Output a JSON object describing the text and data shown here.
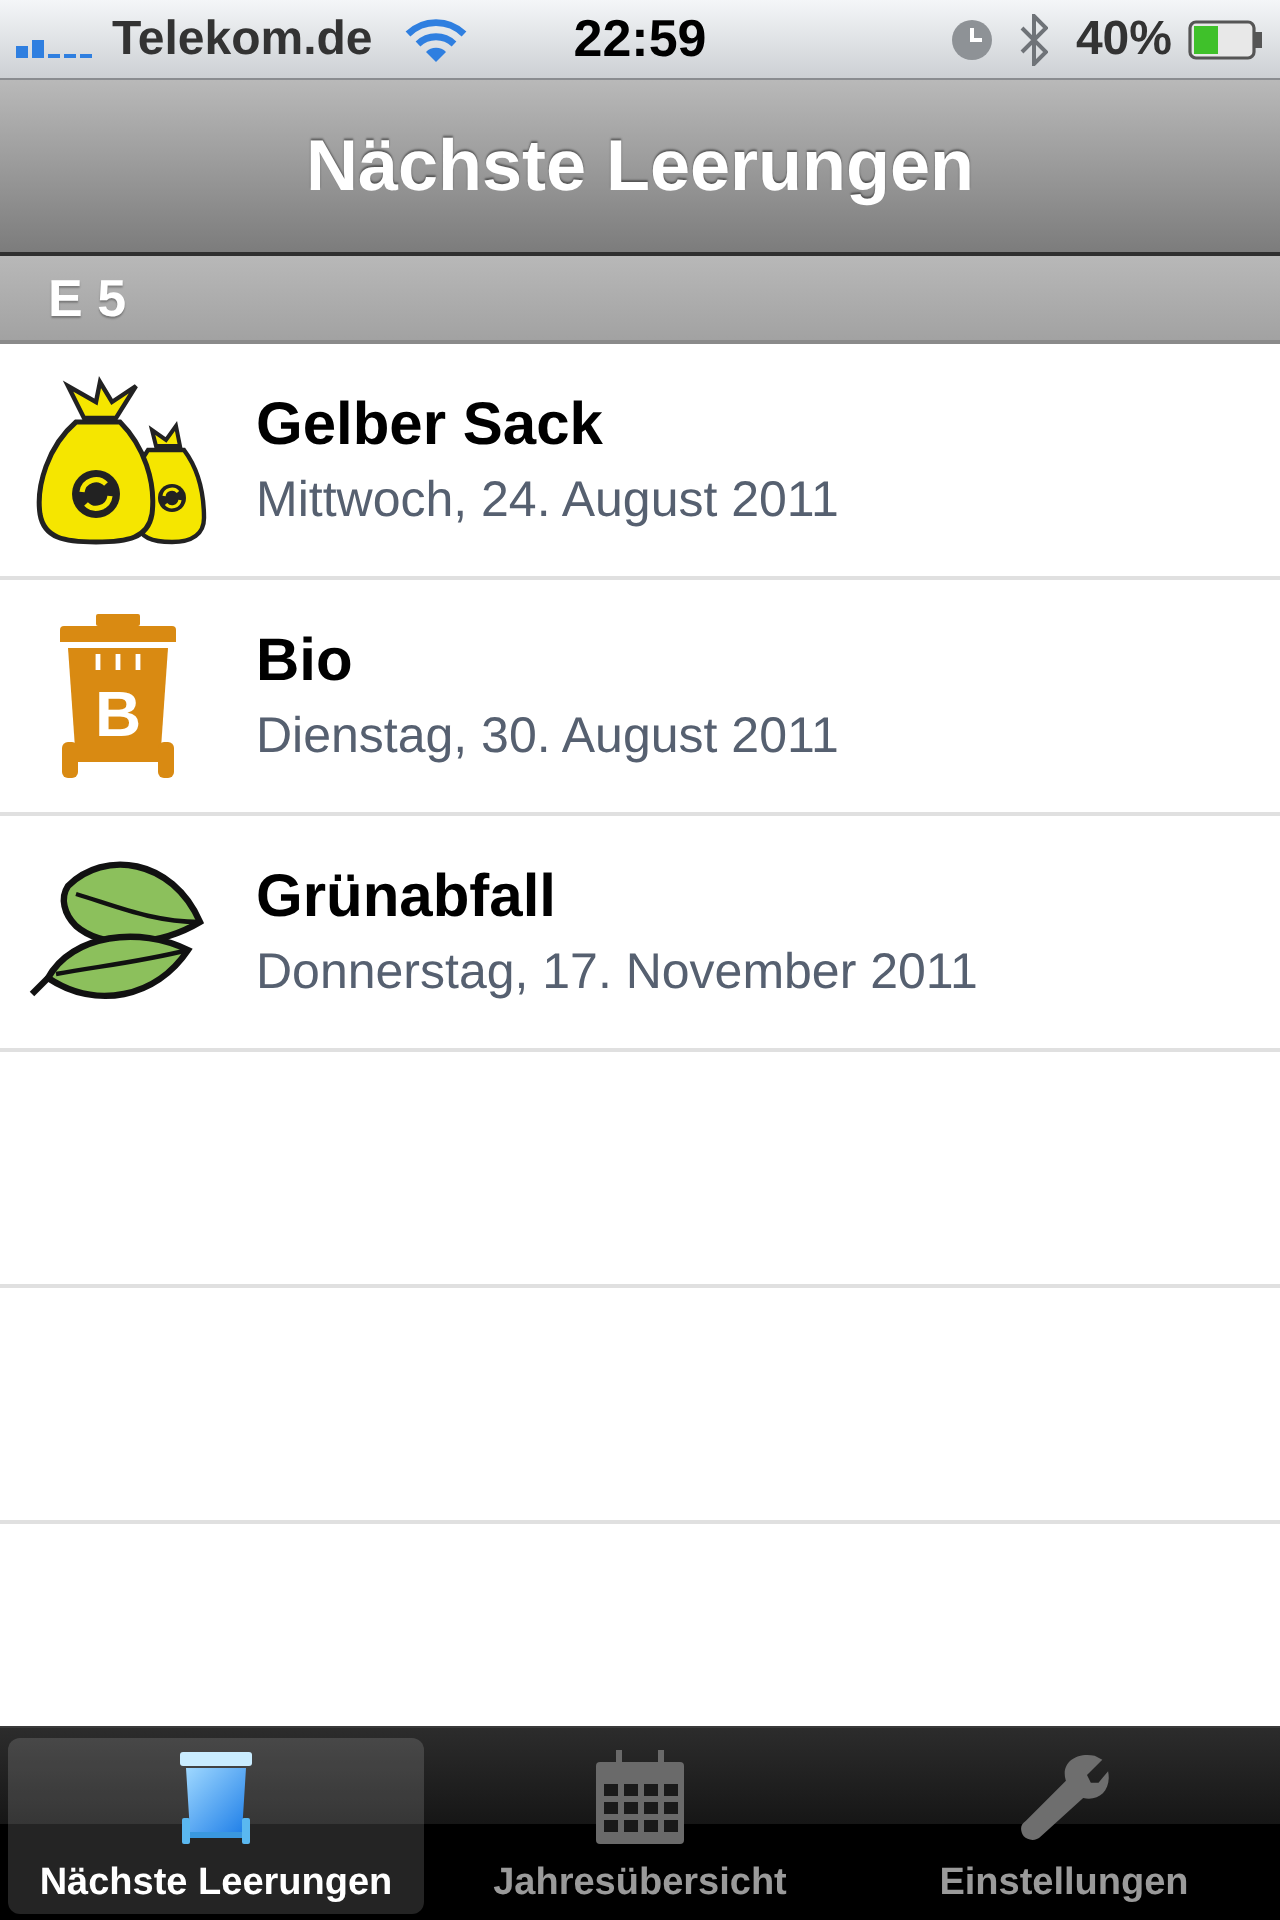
{
  "status_bar": {
    "carrier": "Telekom.de",
    "time": "22:59",
    "battery": "40%"
  },
  "nav_bar": {
    "title": "Nächste Leerungen"
  },
  "section": {
    "title": "E 5"
  },
  "items": [
    {
      "kind": "bags",
      "title": "Gelber Sack",
      "date": "Mittwoch, 24. August 2011"
    },
    {
      "kind": "bin",
      "icon_letter": "B",
      "title": "Bio",
      "date": "Dienstag, 30. August 2011"
    },
    {
      "kind": "leaves",
      "title": "Grünabfall",
      "date": "Donnerstag, 17. November 2011"
    }
  ],
  "tab_bar": {
    "tabs": [
      {
        "kind": "bin",
        "label": "Nächste Leerungen",
        "selected": true
      },
      {
        "kind": "calendar",
        "label": "Jahresübersicht",
        "selected": false
      },
      {
        "kind": "wrench",
        "label": "Einstellungen",
        "selected": false
      }
    ]
  }
}
